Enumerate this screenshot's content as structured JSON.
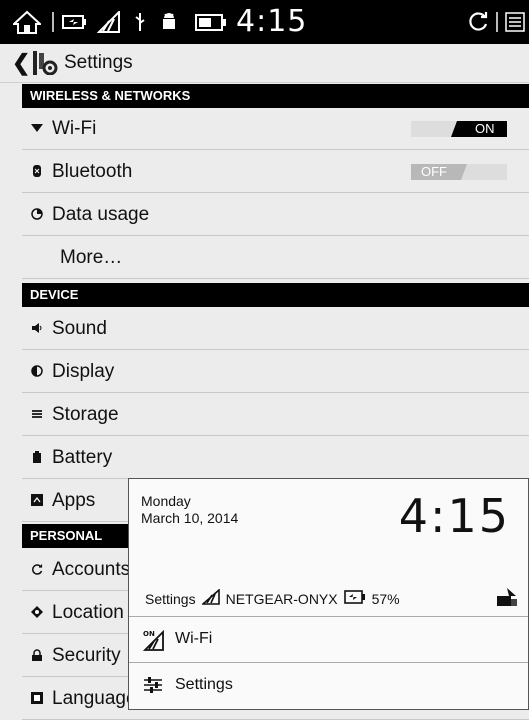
{
  "status_bar": {
    "icons": [
      "home-icon",
      "battery-charging-icon",
      "wifi-signal-icon",
      "usb-icon",
      "android-debug-icon",
      "battery-icon"
    ],
    "time": "4:15",
    "right_icons": [
      "refresh-icon",
      "menu-icon"
    ]
  },
  "action_bar": {
    "title": "Settings",
    "icon": "settings-tools-icon"
  },
  "sections": {
    "wireless": "WIRELESS & NETWORKS",
    "device": "DEVICE",
    "personal": "PERSONAL"
  },
  "rows": {
    "wifi": {
      "label": "Wi-Fi",
      "toggle": "ON"
    },
    "bluetooth": {
      "label": "Bluetooth",
      "toggle": "OFF"
    },
    "data_usage": {
      "label": "Data usage"
    },
    "more": {
      "label": "More…"
    },
    "sound": {
      "label": "Sound"
    },
    "display": {
      "label": "Display"
    },
    "storage": {
      "label": "Storage"
    },
    "battery": {
      "label": "Battery"
    },
    "apps": {
      "label": "Apps"
    },
    "accounts": {
      "label": "Accounts"
    },
    "location": {
      "label": "Location"
    },
    "security": {
      "label": "Security"
    },
    "language": {
      "label": "Language"
    }
  },
  "notification": {
    "day": "Monday",
    "date": "March 10, 2014",
    "time": "4:15",
    "settings_label": "Settings",
    "network": "NETGEAR-ONYX",
    "battery": "57%",
    "wifi_label": "Wi-Fi",
    "settings_row_label": "Settings"
  }
}
